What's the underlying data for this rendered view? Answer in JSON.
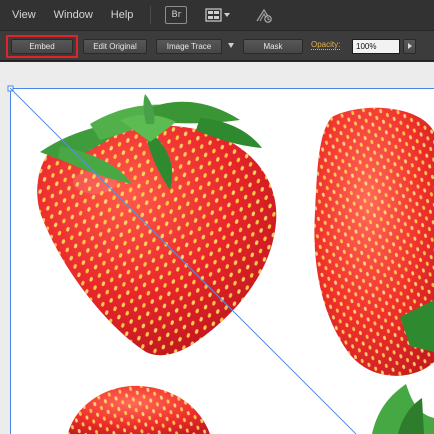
{
  "menu": {
    "items": [
      "View",
      "Window",
      "Help"
    ],
    "bridge_label": "Br",
    "workspace_icon": "workspace-grid-icon",
    "gpu_icon": "gpu-performance-icon"
  },
  "controls": {
    "embed_label": "Embed",
    "edit_original_label": "Edit Original",
    "image_trace_label": "Image Trace",
    "mask_label": "Mask",
    "opacity_label": "Opacity:",
    "opacity_value": "100%"
  },
  "colors": {
    "highlight": "#e0242a",
    "selection": "#4a86e8",
    "strawberry": "#e8262a",
    "leaf": "#3a9a3a"
  }
}
